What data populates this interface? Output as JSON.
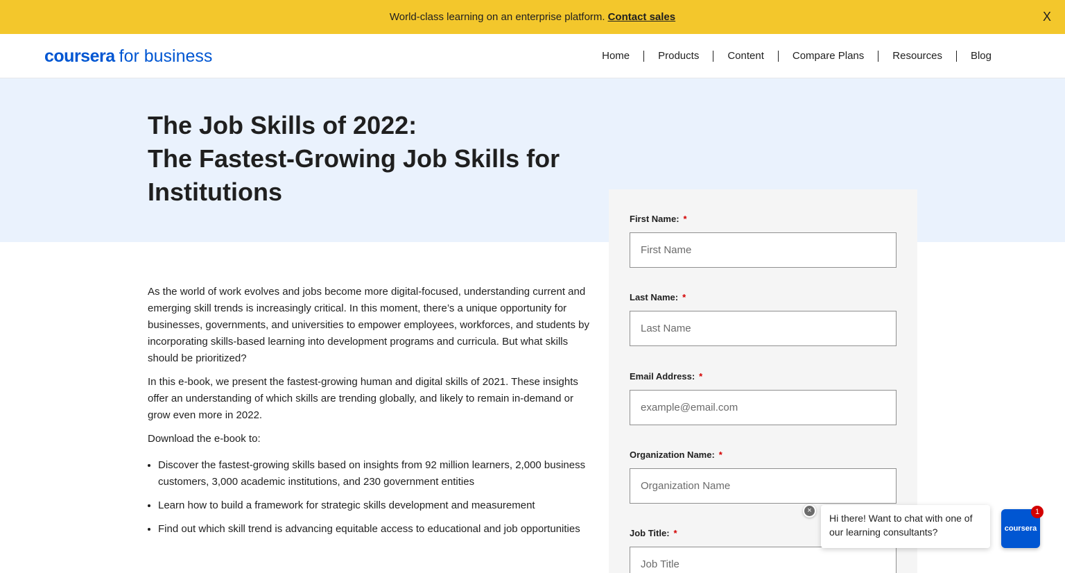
{
  "banner": {
    "text": "World-class learning on an enterprise platform.",
    "link_label": "Contact sales",
    "close_label": "X",
    "background": "#f3c72c"
  },
  "header": {
    "logo_main": "coursera",
    "logo_sub": "for business",
    "nav_items": [
      {
        "label": "Home"
      },
      {
        "label": "Products"
      },
      {
        "label": "Content"
      },
      {
        "label": "Compare Plans"
      },
      {
        "label": "Resources"
      },
      {
        "label": "Blog"
      }
    ]
  },
  "hero": {
    "title_line1": "The Job Skills of 2022:",
    "title_line2": "The Fastest-Growing Job Skills for Institutions",
    "background": "#eaf2fd"
  },
  "main": {
    "paragraphs": [
      "As the world of work evolves and jobs become more digital-focused, understanding current and emerging skill trends is increasingly critical. In this moment, there’s a unique opportunity for businesses, governments, and universities to empower employees, workforces, and students by incorporating skills-based learning into development programs and curricula. But what skills should be prioritized?",
      "In this e-book, we present the fastest-growing human and digital skills of 2021. These insights offer an understanding of which skills are trending globally, and likely to remain in-demand or grow even more in 2022.",
      "Download the e-book to:"
    ],
    "bullets": [
      "Discover the fastest-growing skills based on insights from 92 million learners, 2,000 business customers, 3,000 academic institutions, and 230 government entities",
      "Learn how to build a framework for strategic skills development and measurement",
      "Find out which skill trend is advancing equitable access to educational and job opportunities"
    ]
  },
  "form": {
    "required_marker": "*",
    "fields": [
      {
        "label": "First Name:",
        "placeholder": "First Name",
        "value": ""
      },
      {
        "label": "Last Name:",
        "placeholder": "Last Name",
        "value": ""
      },
      {
        "label": "Email Address:",
        "placeholder": "example@email.com",
        "value": ""
      },
      {
        "label": "Organization Name:",
        "placeholder": "Organization Name",
        "value": ""
      },
      {
        "label": "Job Title:",
        "placeholder": "Job Title",
        "value": ""
      }
    ]
  },
  "chat": {
    "message": "Hi there! Want to chat with one of our learning consultants?",
    "close_label": "×",
    "launcher_label": "coursera",
    "badge_count": "1",
    "accent": "#0056d2"
  }
}
